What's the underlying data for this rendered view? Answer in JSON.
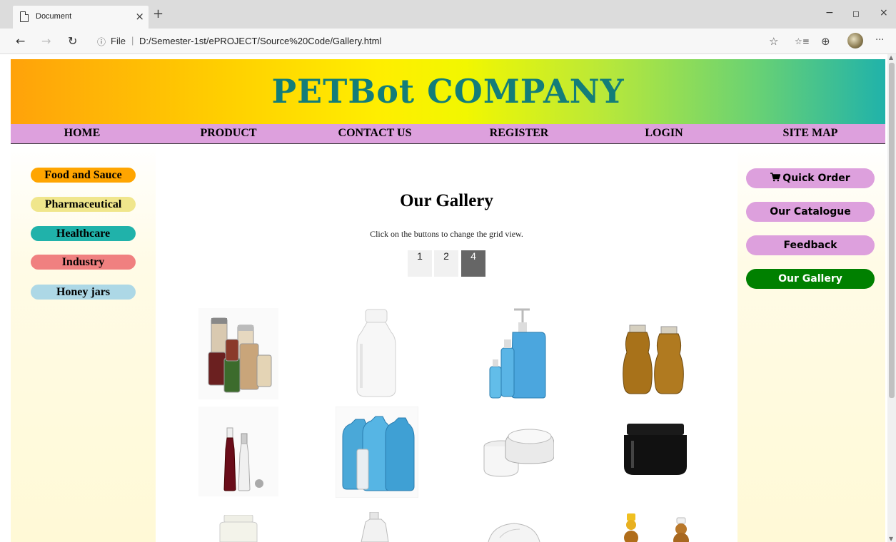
{
  "browser": {
    "tab_title": "Document",
    "tab_close": "×",
    "new_tab": "+",
    "url_scheme_label": "File",
    "url_separator": "|",
    "url": "D:/Semester-1st/ePROJECT/Source%20Code/Gallery.html",
    "window_controls": {
      "minimize": "−",
      "maximize": "◻",
      "close": "×"
    },
    "nav_glyphs": {
      "back": "←",
      "forward": "→",
      "refresh": "↻",
      "info": "ⓘ"
    },
    "tool_glyphs": {
      "favorite": "☆",
      "favorites_list": "☆≡",
      "collections": "⊕",
      "more": "···"
    }
  },
  "site": {
    "title": "PETBot COMPANY",
    "nav": [
      "HOME",
      "PRODUCT",
      "CONTACT US",
      "REGISTER",
      "LOGIN",
      "SITE MAP"
    ],
    "categories": [
      {
        "label": "Food and Sauce",
        "color": "#ffa500"
      },
      {
        "label": "Pharmaceutical",
        "color": "#f0e68c"
      },
      {
        "label": "Healthcare",
        "color": "#20b2aa"
      },
      {
        "label": "Industry",
        "color": "#f08080"
      },
      {
        "label": "Honey jars",
        "color": "#add8e6"
      }
    ],
    "side_buttons": [
      {
        "label": "Quick Order",
        "icon": "cart-icon",
        "color": "#dda0dd"
      },
      {
        "label": "Our Catalogue",
        "color": "#dda0dd"
      },
      {
        "label": "Feedback",
        "color": "#dda0dd"
      },
      {
        "label": "Our Gallery",
        "color": "#008000"
      }
    ]
  },
  "gallery": {
    "heading": "Our Gallery",
    "description": "Click on the buttons to change the grid view.",
    "grid_buttons": [
      {
        "label": "1",
        "active": false
      },
      {
        "label": "2",
        "active": false
      },
      {
        "label": "4",
        "active": true
      }
    ],
    "images": [
      {
        "name": "spice-jars-image"
      },
      {
        "name": "white-bottle-image"
      },
      {
        "name": "blue-pump-bottles-image"
      },
      {
        "name": "honey-bottles-image"
      },
      {
        "name": "sauce-bottles-image"
      },
      {
        "name": "blue-jugs-image"
      },
      {
        "name": "white-cream-jars-image"
      },
      {
        "name": "black-jar-image"
      },
      {
        "name": "white-wide-jar-image"
      },
      {
        "name": "white-jug-image"
      },
      {
        "name": "clear-bowl-image"
      },
      {
        "name": "bear-honey-bottles-image"
      }
    ]
  }
}
